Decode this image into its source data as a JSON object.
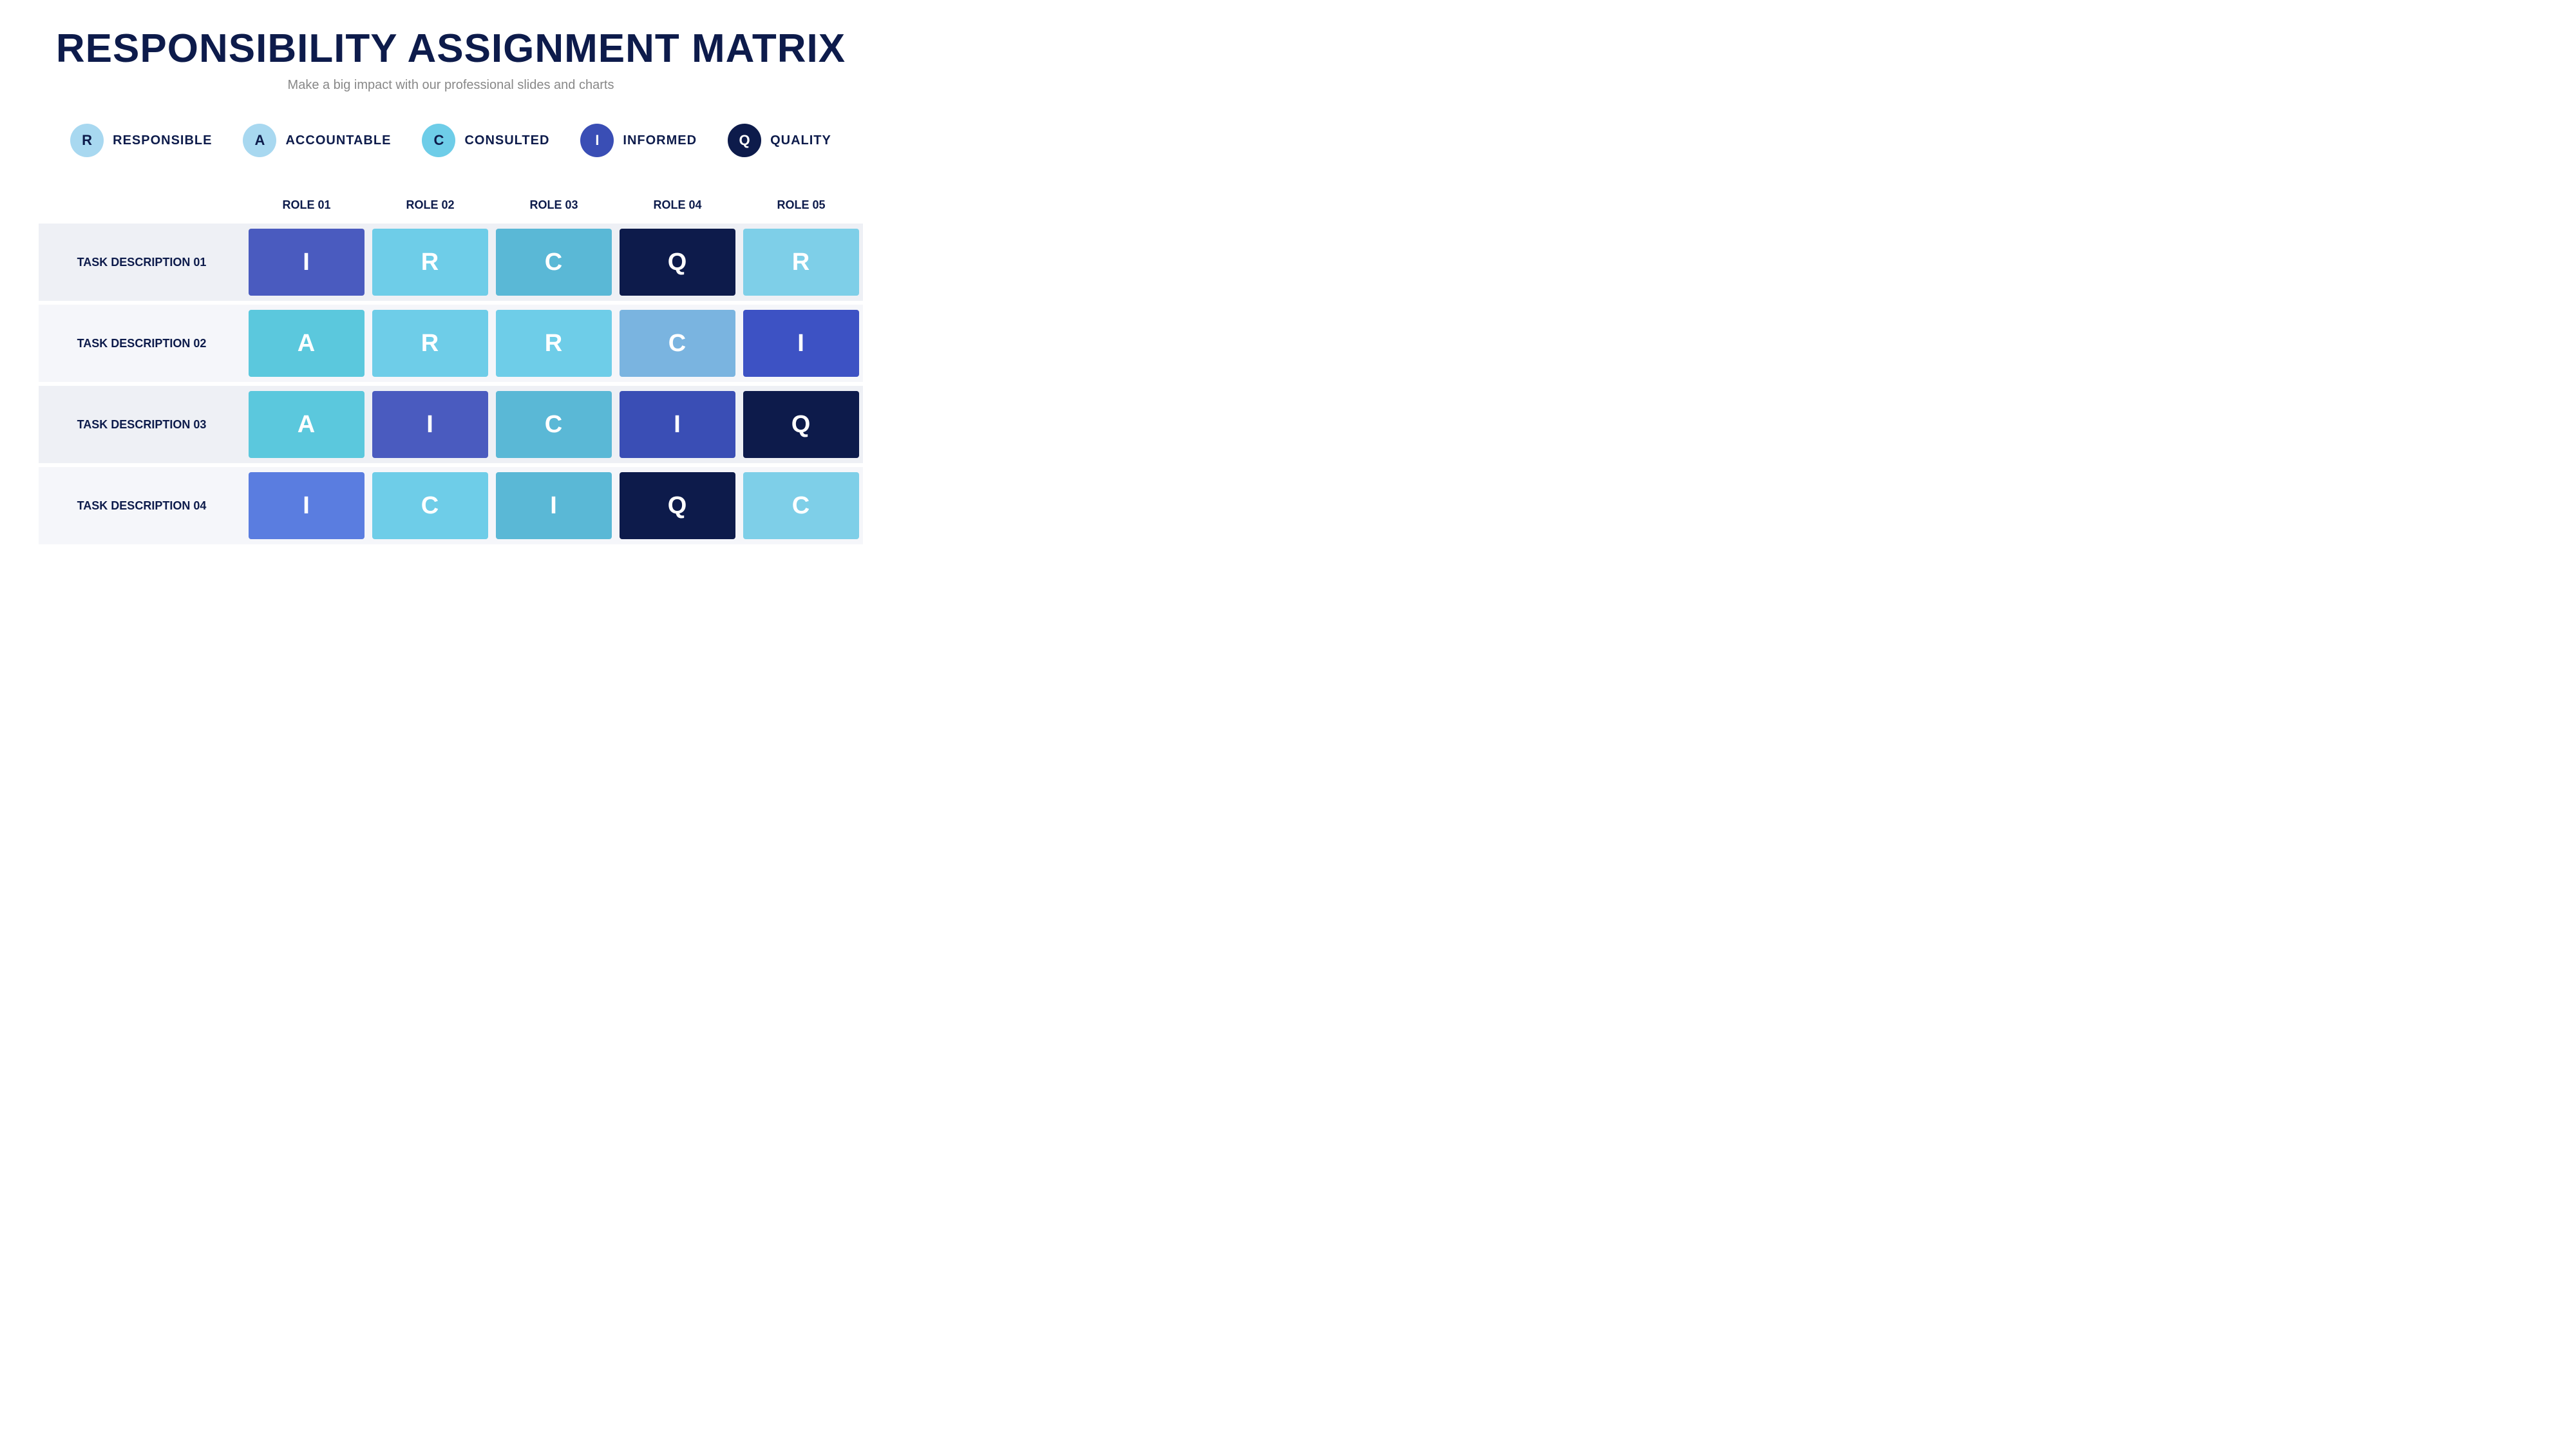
{
  "header": {
    "title": "RESPONSIBILITY ASSIGNMENT MATRIX",
    "subtitle": "Make a big impact with our professional slides and charts"
  },
  "legend": [
    {
      "id": "R",
      "label": "RESPONSIBLE",
      "bg": "#a8d8f0",
      "color": "#0d1b4b"
    },
    {
      "id": "A",
      "label": "ACCOUNTABLE",
      "bg": "#a8d8f0",
      "color": "#0d1b4b"
    },
    {
      "id": "C",
      "label": "CONSULTED",
      "bg": "#6ecde8",
      "color": "#0d1b4b"
    },
    {
      "id": "I",
      "label": "INFORMED",
      "bg": "#3a4eb5",
      "color": "#ffffff"
    },
    {
      "id": "Q",
      "label": "QUALITY",
      "bg": "#0d1b4b",
      "color": "#ffffff"
    }
  ],
  "matrix": {
    "columns": [
      "",
      "ROLE 01",
      "ROLE 02",
      "ROLE 03",
      "ROLE 04",
      "ROLE 05"
    ],
    "rows": [
      {
        "task": "TASK DESCRIPTION 01",
        "cells": [
          {
            "letter": "I",
            "style": "bg-blue-medium"
          },
          {
            "letter": "R",
            "style": "bg-cyan-light"
          },
          {
            "letter": "C",
            "style": "bg-blue-light"
          },
          {
            "letter": "Q",
            "style": "bg-navy"
          },
          {
            "letter": "R",
            "style": "bg-cyan-pale"
          }
        ]
      },
      {
        "task": "TASK DESCRIPTION 02",
        "cells": [
          {
            "letter": "A",
            "style": "bg-cyan-medium"
          },
          {
            "letter": "R",
            "style": "bg-cyan-light"
          },
          {
            "letter": "R",
            "style": "bg-cyan-light"
          },
          {
            "letter": "C",
            "style": "bg-blue-soft"
          },
          {
            "letter": "I",
            "style": "bg-blue-strong"
          }
        ]
      },
      {
        "task": "TASK DESCRIPTION 03",
        "cells": [
          {
            "letter": "A",
            "style": "bg-cyan-medium"
          },
          {
            "letter": "I",
            "style": "bg-blue-medium"
          },
          {
            "letter": "C",
            "style": "bg-blue-light"
          },
          {
            "letter": "I",
            "style": "bg-blue-dark"
          },
          {
            "letter": "Q",
            "style": "bg-navy"
          }
        ]
      },
      {
        "task": "TASK DESCRIPTION 04",
        "cells": [
          {
            "letter": "I",
            "style": "bg-blue-mid"
          },
          {
            "letter": "C",
            "style": "bg-cyan-light"
          },
          {
            "letter": "I",
            "style": "bg-blue-light"
          },
          {
            "letter": "Q",
            "style": "bg-navy"
          },
          {
            "letter": "C",
            "style": "bg-cyan-pale"
          }
        ]
      }
    ]
  }
}
